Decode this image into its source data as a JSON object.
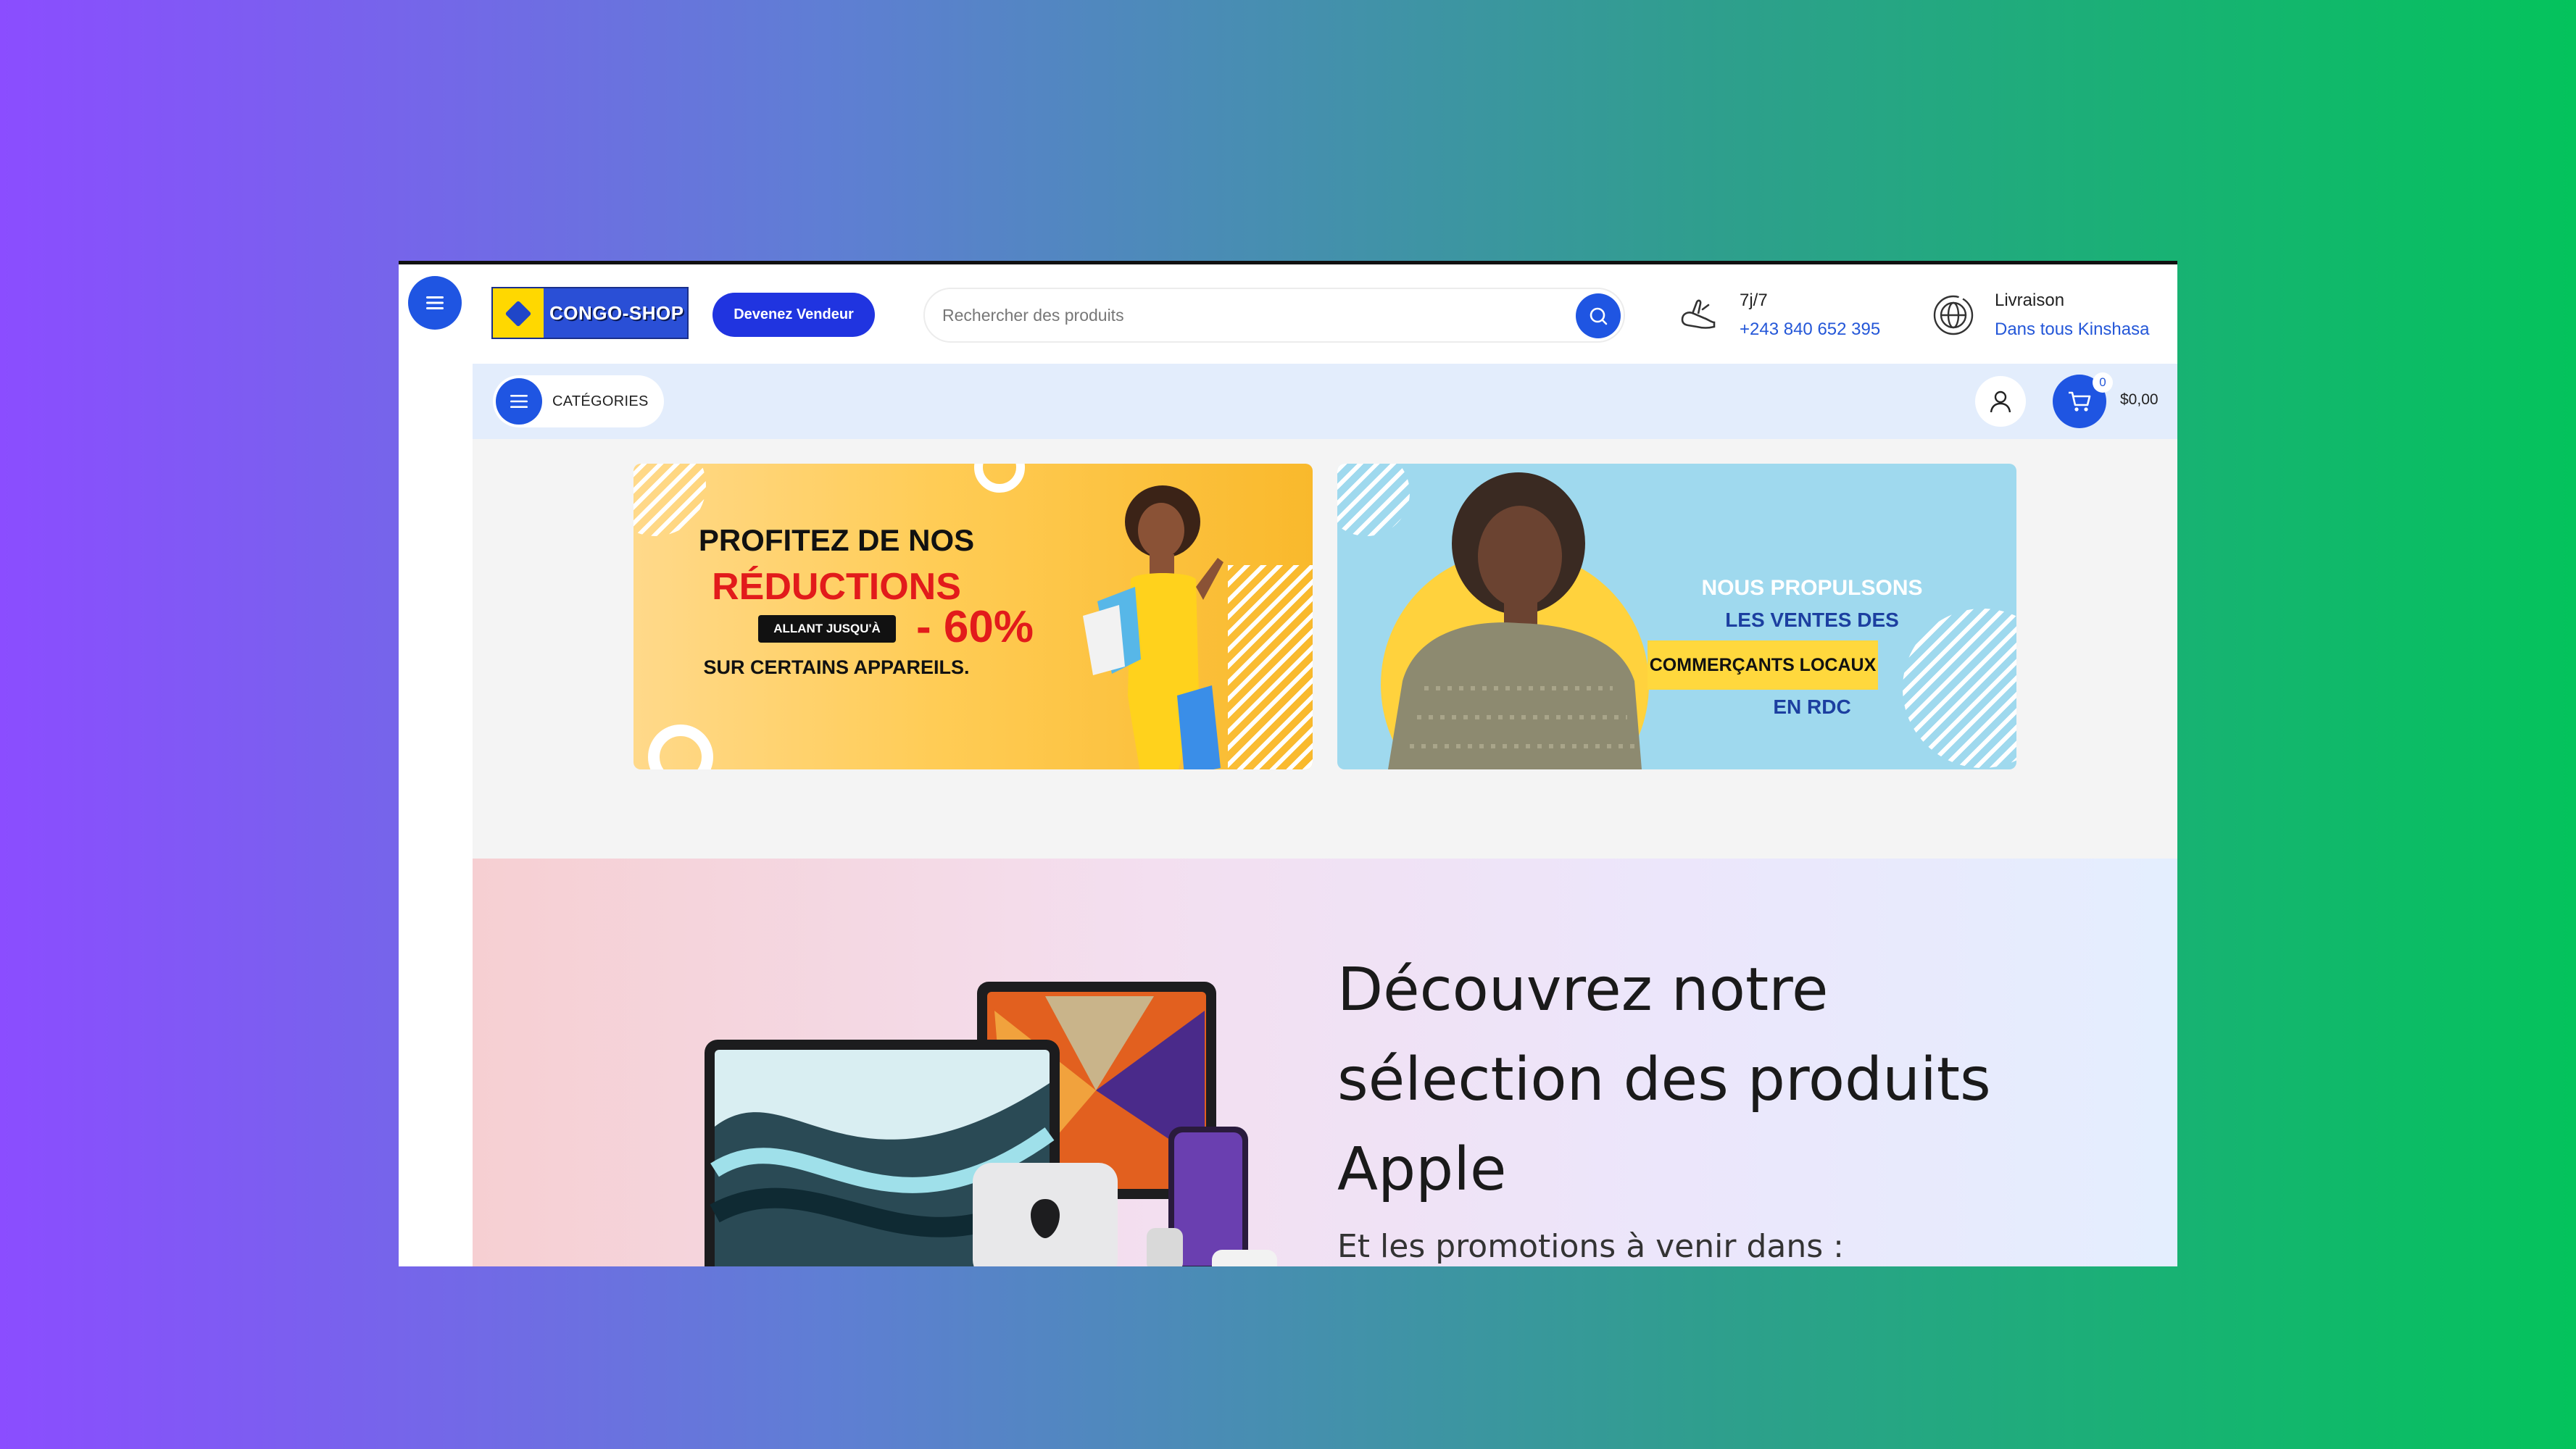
{
  "brand": {
    "logo_text": "CONGO-SHOP"
  },
  "header": {
    "vendor_button": "Devenez Vendeur",
    "search_placeholder": "Rechercher des produits",
    "support": {
      "title": "7j/7",
      "phone": "+243 840 652 395"
    },
    "delivery": {
      "title": "Livraison",
      "subtitle": "Dans tous Kinshasa"
    }
  },
  "navbar": {
    "categories_label": "CATÉGORIES",
    "cart_count": "0",
    "cart_total": "$0,00"
  },
  "banners": [
    {
      "line1": "PROFITEZ DE NOS",
      "line2": "RÉDUCTIONS",
      "tag": "ALLANT JUSQU'À",
      "percent": "- 60%",
      "line4": "SUR CERTAINS APPAREILS."
    },
    {
      "line1": "NOUS PROPULSONS",
      "line2": "LES VENTES DES",
      "line3": "COMMERÇANTS LOCAUX",
      "line4": "EN RDC"
    }
  ],
  "promo": {
    "heading": "Découvrez notre sélection des produits Apple",
    "subheading": "Et les promotions à venir dans :"
  },
  "colors": {
    "accent": "#1f55e2",
    "navbar_bg": "#e3edfc",
    "logo_yellow": "#ffd800"
  },
  "icons": [
    "menu-icon",
    "search-icon",
    "phone-icon",
    "globe-icon",
    "user-icon",
    "cart-icon"
  ]
}
